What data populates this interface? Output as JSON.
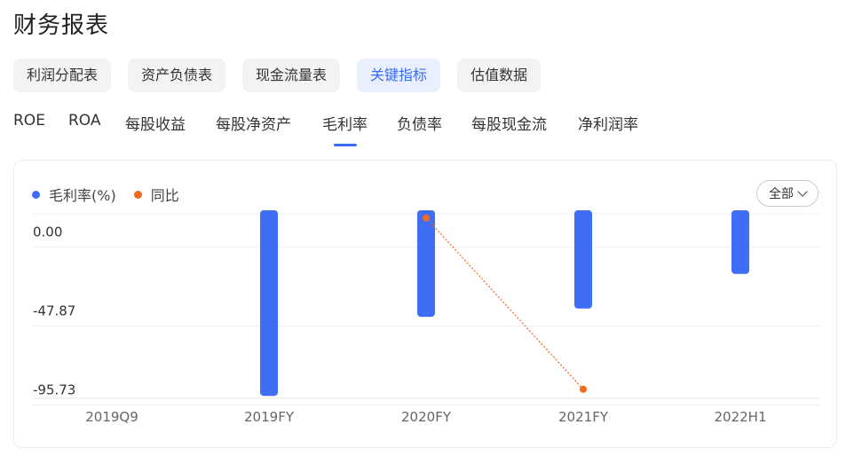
{
  "page_title": "财务报表",
  "tabs": [
    {
      "label": "利润分配表",
      "active": false
    },
    {
      "label": "资产负债表",
      "active": false
    },
    {
      "label": "现金流量表",
      "active": false
    },
    {
      "label": "关键指标",
      "active": true
    },
    {
      "label": "估值数据",
      "active": false
    }
  ],
  "subtabs": [
    {
      "label": "ROE",
      "active": false
    },
    {
      "label": "ROA",
      "active": false
    },
    {
      "label": "每股收益",
      "active": false
    },
    {
      "label": "每股净资产",
      "active": false
    },
    {
      "label": "毛利率",
      "active": true
    },
    {
      "label": "负债率",
      "active": false
    },
    {
      "label": "每股现金流",
      "active": false
    },
    {
      "label": "净利润率",
      "active": false
    }
  ],
  "filter": {
    "label": "全部",
    "icon": "chevron-down-icon"
  },
  "colors": {
    "accent": "#3b6cf6",
    "bar": "#3d6ef5",
    "yoy": "#f26a1b"
  },
  "chart_data": {
    "type": "bar",
    "categories": [
      "2019Q9",
      "2019FY",
      "2020FY",
      "2021FY",
      "2022H1"
    ],
    "series": [
      {
        "name": "毛利率(%)",
        "type": "bar",
        "values": [
          null,
          -100.5,
          -52.5,
          -47.5,
          -26.5
        ]
      },
      {
        "name": "同比",
        "type": "line",
        "values": [
          null,
          null,
          7.5,
          -96.5,
          null
        ]
      }
    ],
    "yticks": [
      "0.00",
      "-47.87",
      "-95.73"
    ],
    "ytick_values": [
      0,
      -47.87,
      -95.73
    ],
    "ylim": [
      -102,
      10
    ],
    "legend": "top-left",
    "grid": true
  }
}
